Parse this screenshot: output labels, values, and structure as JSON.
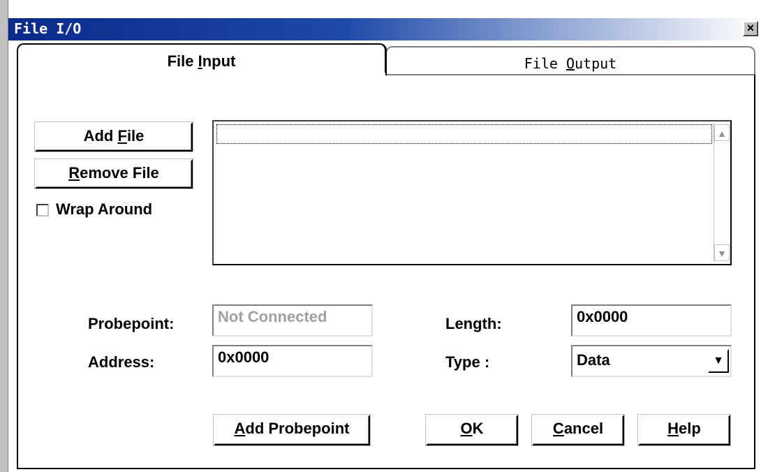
{
  "window": {
    "title": "File I/O",
    "close_glyph": "×"
  },
  "tabs": [
    {
      "label_pre": "File ",
      "label_key": "I",
      "label_post": "nput",
      "active": true
    },
    {
      "label_pre": "File ",
      "label_key": "O",
      "label_post": "utput",
      "active": false
    }
  ],
  "file_input": {
    "add_file": {
      "pre": "Add ",
      "key": "F",
      "post": "ile"
    },
    "remove_file": {
      "pre": "",
      "key": "R",
      "post": "emove File"
    },
    "wrap_around": {
      "label": "Wrap Around",
      "checked": false
    },
    "file_list": {
      "items": [],
      "scroll_up_icon": "scroll-up-arrow-icon",
      "scroll_down_icon": "scroll-down-arrow-icon"
    },
    "probepoint": {
      "label": "Probepoint:",
      "value": "Not Connected"
    },
    "address": {
      "label": "Address:",
      "value": "0x0000"
    },
    "length": {
      "label": "Length:",
      "value": "0x0000"
    },
    "type": {
      "label": "Type :",
      "value": "Data"
    }
  },
  "buttons": {
    "add_probepoint": {
      "pre": "",
      "key": "A",
      "post": "dd Probepoint"
    },
    "ok": {
      "pre": "",
      "key": "O",
      "post": "K"
    },
    "cancel": {
      "pre": "",
      "key": "C",
      "post": "ancel"
    },
    "help": {
      "pre": "",
      "key": "H",
      "post": "elp"
    }
  }
}
